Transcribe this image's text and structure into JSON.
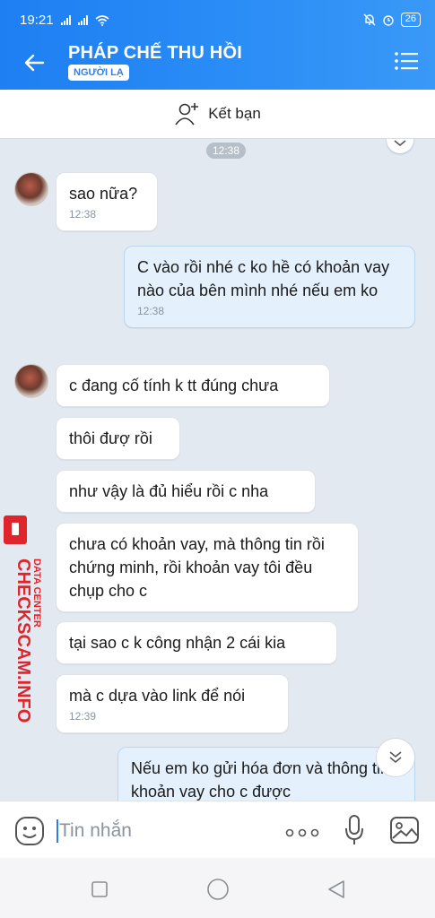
{
  "status_bar": {
    "time": "19:21",
    "battery": "26"
  },
  "header": {
    "title": "PHÁP CHẾ THU HỒI",
    "tag": "NGƯỜI LẠ"
  },
  "friend_bar": {
    "label": "Kết bạn"
  },
  "chat": {
    "date_pill": "12:38",
    "messages": [
      {
        "dir": "in",
        "text": "sao nữa?",
        "time": "12:38"
      },
      {
        "dir": "out",
        "text": "C vào rồi nhé c ko hề có khoản vay nào của bên mình nhé nếu em ko",
        "time": "12:38"
      },
      {
        "dir": "in",
        "text": "c đang cố tính k tt đúng chưa"
      },
      {
        "dir": "in",
        "text": "thôi đượ rồi"
      },
      {
        "dir": "in",
        "text": "như vậy là đủ hiểu rồi c nha"
      },
      {
        "dir": "in",
        "text": "chưa có khoản vay, mà thông tin rồi chứng minh, rồi khoản vay tôi đều chụp cho c"
      },
      {
        "dir": "in",
        "text": "tại sao c k công nhận 2 cái kia"
      },
      {
        "dir": "in",
        "text": "mà c dựa vào link để nói",
        "time": "12:39"
      },
      {
        "dir": "out",
        "text": "Nếu em ko gửi hóa đơn và thông tin khoản vay cho c được"
      }
    ]
  },
  "watermark": {
    "brand": "CHECKSCAM.INFO",
    "sub": "DATA CENTER"
  },
  "composer": {
    "placeholder": "Tin nhắn"
  },
  "icons": {
    "back": "arrow-left-icon",
    "menu": "list-menu-icon",
    "add_friend": "add-friend-icon",
    "emoji": "emoji-icon",
    "more": "more-dots-icon",
    "mic": "microphone-icon",
    "image": "image-icon",
    "scroll_down": "chevron-double-down-icon"
  },
  "colors": {
    "header": "#1d7ff2",
    "out_bubble": "#e4f1fd",
    "chat_bg": "#e2e9f1",
    "watermark": "#e0242b"
  }
}
